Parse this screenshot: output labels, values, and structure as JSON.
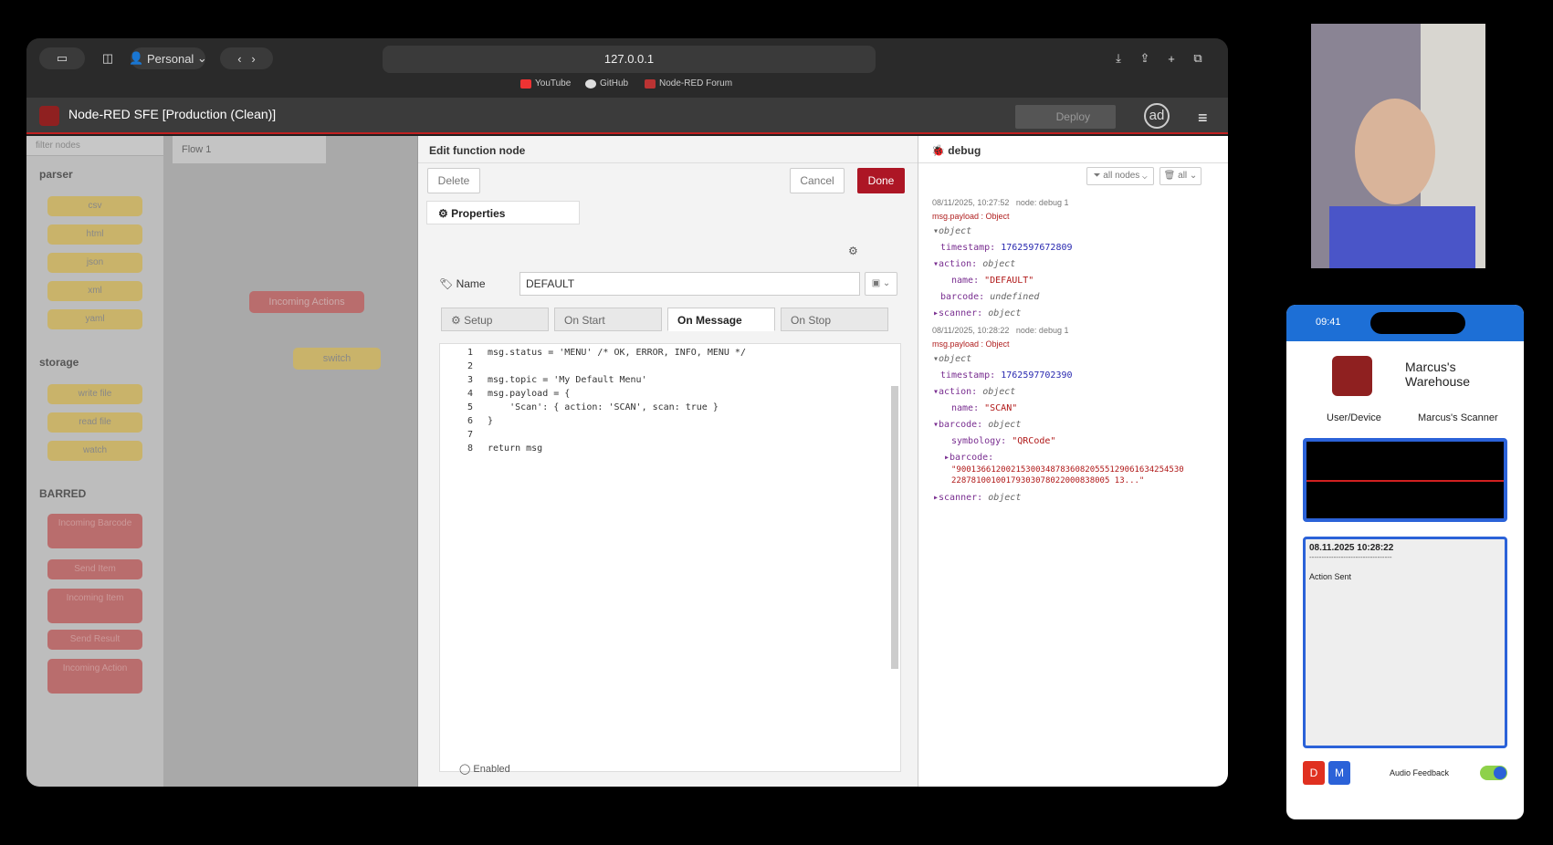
{
  "browser": {
    "profile": "Personal",
    "url": "127.0.0.1",
    "bookmarks": [
      "YouTube",
      "GitHub",
      "Node-RED Forum"
    ]
  },
  "header": {
    "title": "Node-RED SFE [Production (Clean)]",
    "deploy": "Deploy",
    "avatar": "ad"
  },
  "palette": {
    "filter_placeholder": "filter nodes",
    "categories": [
      {
        "name": "parser",
        "nodes": [
          "csv",
          "html",
          "json",
          "xml",
          "yaml"
        ]
      },
      {
        "name": "storage",
        "nodes": [
          "write file",
          "read file",
          "watch"
        ]
      },
      {
        "name": "BARRED",
        "nodes": [
          "Incoming Barcode",
          "Send Item",
          "Incoming Item",
          "Send Result",
          "Incoming Action"
        ]
      }
    ]
  },
  "workspace": {
    "tab": "Flow 1",
    "nodes": [
      "Incoming Actions",
      "switch"
    ]
  },
  "editor": {
    "title": "Edit function node",
    "delete": "Delete",
    "cancel": "Cancel",
    "done": "Done",
    "properties_tab": "Properties",
    "name_label": "Name",
    "name_value": "DEFAULT",
    "tabs": [
      "Setup",
      "On Start",
      "On Message",
      "On Stop"
    ],
    "code": [
      {
        "n": "1",
        "text": "msg.status = 'MENU' /* OK, ERROR, INFO, MENU */"
      },
      {
        "n": "2",
        "text": ""
      },
      {
        "n": "3",
        "text": "msg.topic = 'My Default Menu'"
      },
      {
        "n": "4",
        "text": "msg.payload = {"
      },
      {
        "n": "5",
        "text": "    'Scan': { action: 'SCAN', scan: true }"
      },
      {
        "n": "6",
        "text": "}"
      },
      {
        "n": "7",
        "text": ""
      },
      {
        "n": "8",
        "text": "return msg"
      }
    ],
    "enabled": "Enabled"
  },
  "debug": {
    "title": "debug",
    "filter_nodes": "all nodes",
    "filter_all": "all",
    "messages": [
      {
        "meta": "08/11/2025, 10:27:52   node: debug 1",
        "type": "msg.payload : Object",
        "timestamp": "1762597672809",
        "action_name": "\"DEFAULT\"",
        "barcode": "undefined"
      },
      {
        "meta": "08/11/2025, 10:28:22   node: debug 1",
        "type": "msg.payload : Object",
        "timestamp": "1762597702390",
        "action_name": "\"SCAN\"",
        "symbology": "\"QRCode\"",
        "barcode_val1": "\"9001366120021530034878360820555129061634254530",
        "barcode_val2": "22878100100179303078022000838005 13...\""
      }
    ]
  },
  "phone": {
    "time": "09:41",
    "warehouse": "Marcus's\nWarehouse",
    "user_label": "User/Device",
    "device": "Marcus's Scanner",
    "log_time": "08.11.2025 10:28:22",
    "log_sep": "----------------------------------",
    "log_msg": "Action Sent",
    "btn_d": "D",
    "btn_m": "M",
    "audio": "Audio Feedback"
  }
}
